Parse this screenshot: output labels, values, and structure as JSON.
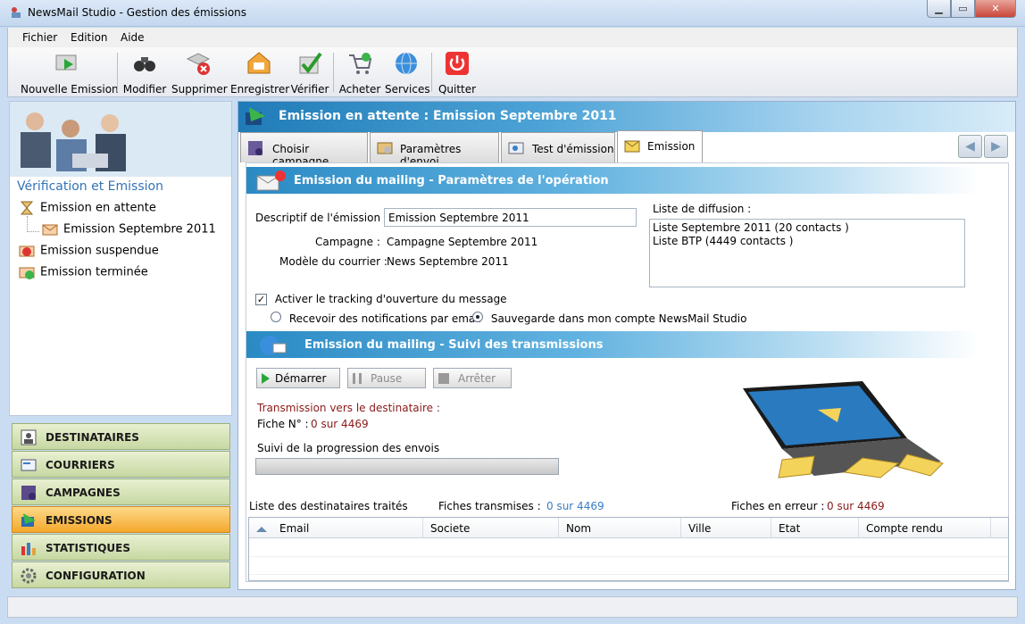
{
  "window": {
    "title": "NewsMail Studio - Gestion des émissions",
    "min": "▁",
    "max": "▭",
    "close": "✕"
  },
  "menu": [
    "Fichier",
    "Edition",
    "Aide"
  ],
  "toolbar": {
    "items": [
      "Nouvelle Emission",
      "Modifier",
      "Supprimer",
      "Enregistrer",
      "Vérifier",
      "Acheter",
      "Services",
      "Quitter"
    ]
  },
  "left": {
    "title": "Vérification et Emission",
    "tree": [
      "Emission en attente",
      "Emission Septembre 2011",
      "Emission suspendue",
      "Emission terminée"
    ]
  },
  "nav": [
    "DESTINATAIRES",
    "COURRIERS",
    "CAMPAGNES",
    "EMISSIONS",
    "STATISTIQUES",
    "CONFIGURATION"
  ],
  "main": {
    "header": "Emission en attente : Emission Septembre 2011",
    "tabs": [
      "Choisir campagne",
      "Paramètres d'envoi",
      "Test d'émission",
      "Emission"
    ],
    "nav_prev": "◀",
    "nav_next": "▶",
    "section1": "Emission du mailing - Paramètres de l'opération",
    "descriptif_label": "Descriptif de l'émission :",
    "descriptif_value": "Emission Septembre 2011",
    "campagne_label": "Campagne :",
    "campagne_value": "Campagne Septembre 2011",
    "modele_label": "Modèle du courrier :",
    "modele_value": "News Septembre 2011",
    "liste_label": "Liste de diffusion :",
    "listes": [
      "Liste Septembre 2011  (20 contacts )",
      "Liste BTP  (4449 contacts )"
    ],
    "tracking_label": "Activer le tracking d'ouverture du message",
    "tracking_mark": "✓",
    "radio1": "Recevoir des notifications par email",
    "radio2": "Sauvegarde dans mon compte NewsMail Studio",
    "section2": "Emission du mailing - Suivi des transmissions",
    "btn_start": "Démarrer",
    "btn_pause": "Pause",
    "btn_stop": "Arrêter",
    "transmission": "Transmission vers le destinataire :",
    "fiche_label": "Fiche N° :",
    "fiche_value": "0 sur 4469",
    "suivi": "Suivi de la progression des envois",
    "progress": 0,
    "liste_traites": "Liste des destinataires traités",
    "fiches_transmises_label": "Fiches transmises :",
    "fiches_transmises_value": "0 sur 4469",
    "fiches_erreur_label": "Fiches en erreur :",
    "fiches_erreur_value": "0 sur 4469",
    "columns": [
      "Email",
      "Societe",
      "Nom",
      "Ville",
      "Etat",
      "Compte rendu"
    ]
  }
}
